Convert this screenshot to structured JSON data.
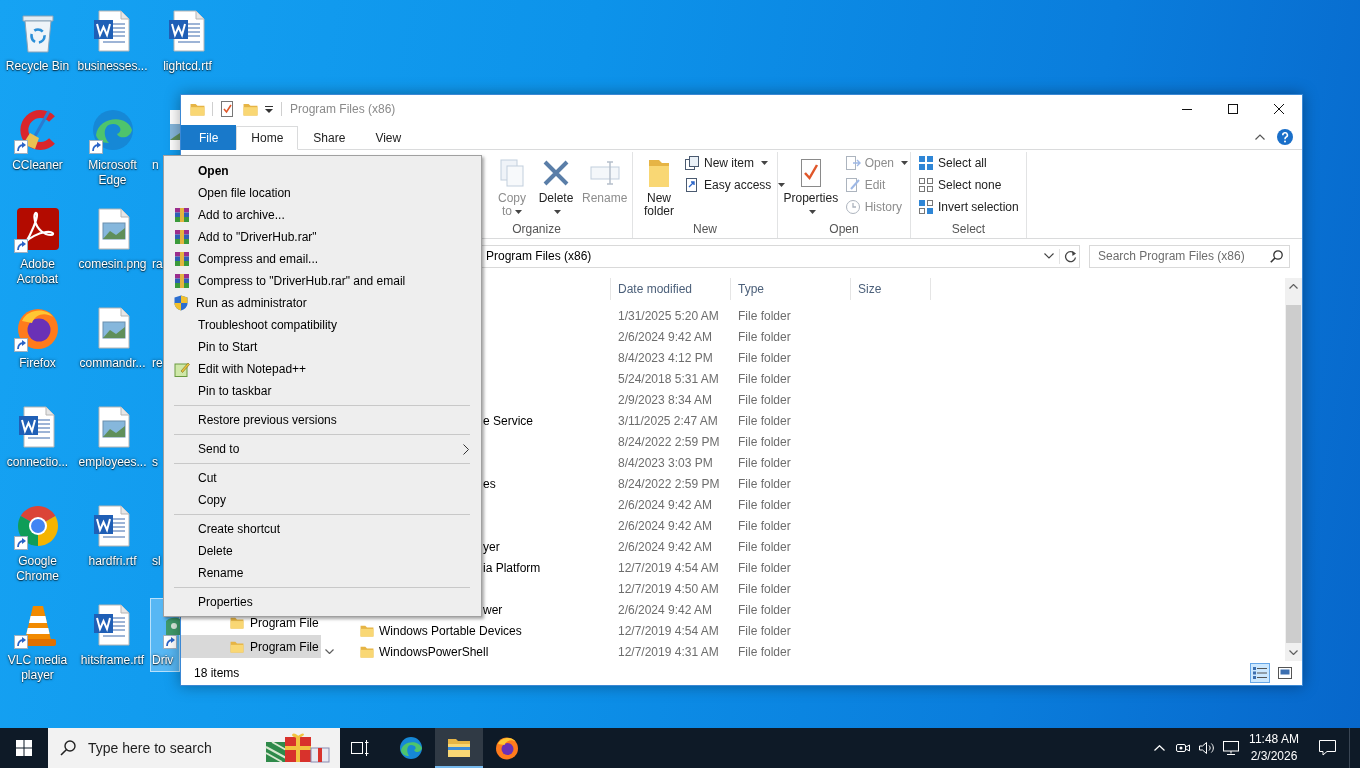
{
  "desktop": {
    "columns": [
      [
        {
          "label": "Recycle Bin",
          "kind": "bin",
          "shortcut": false,
          "selected": false
        },
        {
          "label": "CCleaner",
          "kind": "app",
          "shortcut": true,
          "selected": false
        },
        {
          "label": "Adobe Acrobat",
          "kind": "app",
          "shortcut": true,
          "selected": false
        },
        {
          "label": "Firefox",
          "kind": "app",
          "shortcut": true,
          "selected": false
        },
        {
          "label": "connectio...",
          "kind": "word",
          "shortcut": false,
          "selected": false
        },
        {
          "label": "Google Chrome",
          "kind": "app",
          "shortcut": true,
          "selected": false
        },
        {
          "label": "VLC media player",
          "kind": "app",
          "shortcut": true,
          "selected": false
        }
      ],
      [
        {
          "label": "businesses...",
          "kind": "word",
          "shortcut": false,
          "selected": false
        },
        {
          "label": "Microsoft Edge",
          "kind": "app",
          "shortcut": true,
          "selected": false
        },
        {
          "label": "comesin.png",
          "kind": "image",
          "shortcut": false,
          "selected": false
        },
        {
          "label": "commandr...",
          "kind": "image",
          "shortcut": false,
          "selected": false
        },
        {
          "label": "employees...",
          "kind": "image",
          "shortcut": false,
          "selected": false
        },
        {
          "label": "hardfri.rtf",
          "kind": "word",
          "shortcut": false,
          "selected": false
        },
        {
          "label": "hitsframe.rtf",
          "kind": "word",
          "shortcut": false,
          "selected": false
        }
      ],
      [
        {
          "label": "lightcd.rtf",
          "kind": "word",
          "shortcut": false,
          "selected": false
        },
        {
          "label": "n",
          "kind": "partial-image",
          "shortcut": false,
          "selected": false
        },
        {
          "label": "ra",
          "kind": "covered",
          "shortcut": false,
          "selected": false
        },
        {
          "label": "re",
          "kind": "covered",
          "shortcut": false,
          "selected": false
        },
        {
          "label": "s",
          "kind": "covered",
          "shortcut": false,
          "selected": false
        },
        {
          "label": "sl",
          "kind": "covered",
          "shortcut": false,
          "selected": false
        },
        {
          "label": "Driv",
          "kind": "partial-app",
          "shortcut": true,
          "selected": true
        }
      ]
    ]
  },
  "window": {
    "title": "Program Files (x86)"
  },
  "ribbon": {
    "tabs": [
      {
        "label": "File",
        "kind": "menu",
        "selected": false
      },
      {
        "label": "Home",
        "kind": "tab",
        "selected": true
      },
      {
        "label": "Share",
        "kind": "tab",
        "selected": false
      },
      {
        "label": "View",
        "kind": "tab",
        "selected": false
      }
    ],
    "groups": [
      {
        "label": "Organize",
        "buttons": [
          {
            "label": "Copy to",
            "kind": "large",
            "disabled": true,
            "dropdown": true
          },
          {
            "label": "Delete",
            "kind": "large",
            "disabled": false,
            "dropdown": true
          },
          {
            "label": "Rename",
            "kind": "large",
            "disabled": true,
            "dropdown": false
          }
        ]
      },
      {
        "label": "New",
        "buttons": [
          {
            "label": "New folder",
            "kind": "large",
            "disabled": false,
            "dropdown": false
          },
          {
            "label": "New item",
            "kind": "small",
            "disabled": false,
            "dropdown": true
          },
          {
            "label": "Easy access",
            "kind": "small",
            "disabled": false,
            "dropdown": true
          }
        ]
      },
      {
        "label": "Open",
        "buttons": [
          {
            "label": "Properties",
            "kind": "large",
            "disabled": false,
            "dropdown": true
          },
          {
            "label": "Open",
            "kind": "small",
            "disabled": true,
            "dropdown": true
          },
          {
            "label": "Edit",
            "kind": "small",
            "disabled": true,
            "dropdown": false
          },
          {
            "label": "History",
            "kind": "small",
            "disabled": true,
            "dropdown": false
          }
        ]
      },
      {
        "label": "Select",
        "buttons": [
          {
            "label": "Select all",
            "kind": "small",
            "disabled": false,
            "dropdown": false
          },
          {
            "label": "Select none",
            "kind": "small",
            "disabled": false,
            "dropdown": false
          },
          {
            "label": "Invert selection",
            "kind": "small",
            "disabled": false,
            "dropdown": false
          }
        ]
      }
    ]
  },
  "address_bar": {
    "path": "Program Files (x86)"
  },
  "search": {
    "placeholder": "Search Program Files (x86)"
  },
  "nav_pane": {
    "items": [
      {
        "label": "Program File",
        "selected": false
      },
      {
        "label": "Program File",
        "selected": true
      }
    ]
  },
  "file_list": {
    "columns": [
      {
        "label": "Date modified"
      },
      {
        "label": "Type"
      },
      {
        "label": "Size"
      }
    ],
    "rows": [
      {
        "covered": true,
        "date_modified": "1/31/2025 5:20 AM",
        "type": "File folder"
      },
      {
        "covered": true,
        "date_modified": "2/6/2024 9:42 AM",
        "type": "File folder"
      },
      {
        "covered": true,
        "date_modified": "8/4/2023 4:12 PM",
        "type": "File folder"
      },
      {
        "covered": true,
        "date_modified": "5/24/2018 5:31 AM",
        "type": "File folder"
      },
      {
        "covered": true,
        "date_modified": "2/9/2023 8:34 AM",
        "type": "File folder"
      },
      {
        "name": "e Service",
        "covered": true,
        "date_modified": "3/11/2025 2:47 AM",
        "type": "File folder"
      },
      {
        "covered": true,
        "date_modified": "8/24/2022 2:59 PM",
        "type": "File folder"
      },
      {
        "covered": true,
        "date_modified": "8/4/2023 3:03 PM",
        "type": "File folder"
      },
      {
        "name": "es",
        "covered": true,
        "date_modified": "8/24/2022 2:59 PM",
        "type": "File folder"
      },
      {
        "covered": true,
        "date_modified": "2/6/2024 9:42 AM",
        "type": "File folder"
      },
      {
        "covered": true,
        "date_modified": "2/6/2024 9:42 AM",
        "type": "File folder"
      },
      {
        "name": "yer",
        "covered": true,
        "date_modified": "2/6/2024 9:42 AM",
        "type": "File folder"
      },
      {
        "name": "ia Platform",
        "covered": true,
        "date_modified": "12/7/2019 4:54 AM",
        "type": "File folder"
      },
      {
        "covered": true,
        "date_modified": "12/7/2019 4:50 AM",
        "type": "File folder"
      },
      {
        "name": "wer",
        "covered": true,
        "date_modified": "2/6/2024 9:42 AM",
        "type": "File folder"
      },
      {
        "name": "Windows Portable Devices",
        "covered": false,
        "date_modified": "12/7/2019 4:54 AM",
        "type": "File folder"
      },
      {
        "name": "WindowsPowerShell",
        "covered": false,
        "date_modified": "12/7/2019 4:31 AM",
        "type": "File folder"
      }
    ]
  },
  "status_bar": {
    "text": "18 items",
    "views": [
      {
        "selected": true
      },
      {
        "selected": false
      }
    ]
  },
  "context_menu": {
    "sections": [
      [
        {
          "label": "Open",
          "kind": "default"
        },
        {
          "label": "Open file location",
          "kind": "command"
        },
        {
          "label": "Add to archive...",
          "kind": "command"
        },
        {
          "label": "Add to \"DriverHub.rar\"",
          "kind": "command"
        },
        {
          "label": "Compress and email...",
          "kind": "command"
        },
        {
          "label": "Compress to \"DriverHub.rar\" and email",
          "kind": "command"
        },
        {
          "label": "Run as administrator",
          "kind": "command"
        },
        {
          "label": "Troubleshoot compatibility",
          "kind": "command"
        },
        {
          "label": "Pin to Start",
          "kind": "command"
        },
        {
          "label": "Edit with Notepad++",
          "kind": "command"
        },
        {
          "label": "Pin to taskbar",
          "kind": "command"
        }
      ],
      [
        {
          "label": "Restore previous versions",
          "kind": "command"
        }
      ],
      [
        {
          "label": "Send to",
          "kind": "submenu"
        }
      ],
      [
        {
          "label": "Cut",
          "kind": "command"
        },
        {
          "label": "Copy",
          "kind": "command"
        }
      ],
      [
        {
          "label": "Create shortcut",
          "kind": "command"
        },
        {
          "label": "Delete",
          "kind": "command"
        },
        {
          "label": "Rename",
          "kind": "command"
        }
      ],
      [
        {
          "label": "Properties",
          "kind": "command"
        }
      ]
    ]
  },
  "taskbar": {
    "search": {
      "placeholder": "Type here to search"
    },
    "buttons": [
      {
        "active": false
      },
      {
        "active": false
      },
      {
        "active": true
      },
      {
        "active": false
      }
    ],
    "clock": {
      "time": "11:48 AM",
      "date": "2/3/2026"
    }
  }
}
